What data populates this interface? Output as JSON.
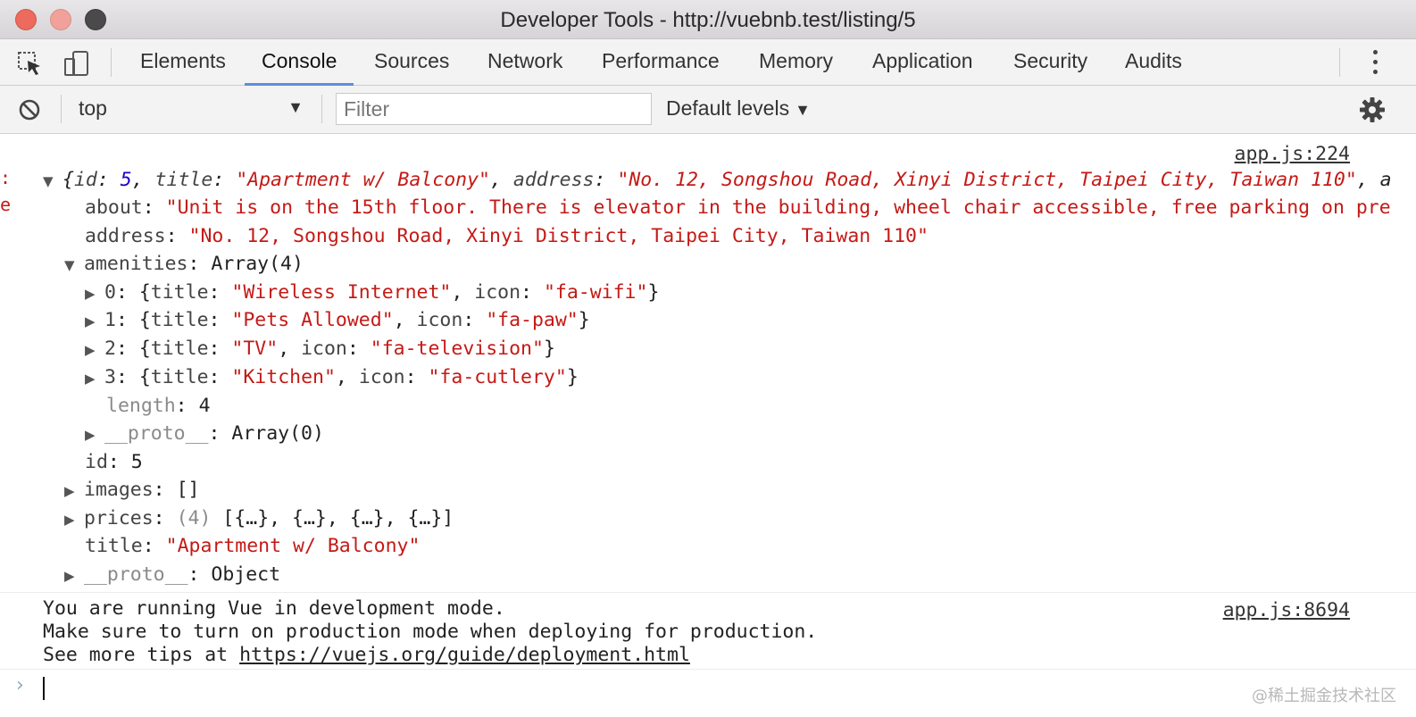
{
  "window": {
    "title": "Developer Tools - http://vuebnb.test/listing/5"
  },
  "tabs": [
    "Elements",
    "Console",
    "Sources",
    "Network",
    "Performance",
    "Memory",
    "Application",
    "Security",
    "Audits"
  ],
  "active_tab": "Console",
  "filterbar": {
    "context": "top",
    "filter_placeholder": "Filter",
    "levels": "Default levels"
  },
  "console": {
    "log1": {
      "source": "app.js:224",
      "summary": {
        "id_key": "id",
        "id_val": "5",
        "title_key": "title",
        "title_val": "\"Apartment w/ Balcony\"",
        "address_key": "address",
        "address_val": "\"No. 12, Songshou Road, Xinyi District, Taipei City, Taiwan 110\"",
        "trail": ", a"
      },
      "about_key": "about",
      "about_val": "\"Unit is on the 15th floor. There is elevator in the building, wheel chair accessible, free parking on pre",
      "address_key": "address",
      "address_val": "\"No. 12, Songshou Road, Xinyi District, Taipei City, Taiwan 110\"",
      "amenities_key": "amenities",
      "amenities_type": "Array(4)",
      "amenities": [
        {
          "index": "0",
          "title": "\"Wireless Internet\"",
          "icon": "\"fa-wifi\""
        },
        {
          "index": "1",
          "title": "\"Pets Allowed\"",
          "icon": "\"fa-paw\""
        },
        {
          "index": "2",
          "title": "\"TV\"",
          "icon": "\"fa-television\""
        },
        {
          "index": "3",
          "title": "\"Kitchen\"",
          "icon": "\"fa-cutlery\""
        }
      ],
      "length_key": "length",
      "length_val": "4",
      "proto_key": "__proto__",
      "arr_proto_val": "Array(0)",
      "id_key": "id",
      "id_val": "5",
      "images_key": "images",
      "images_val": "[]",
      "prices_key": "prices",
      "prices_count": "(4)",
      "prices_val": "[{…}, {…}, {…}, {…}]",
      "title_key": "title",
      "title_val": "\"Apartment w/ Balcony\"",
      "obj_proto_val": "Object"
    },
    "log2": {
      "source": "app.js:8694",
      "line1": "You are running Vue in development mode.",
      "line2": "Make sure to turn on production mode when deploying for production.",
      "line3_prefix": "See more tips at ",
      "line3_link": "https://vuejs.org/guide/deployment.html"
    },
    "prompt": "›"
  },
  "watermark": "@稀土掘金技术社区"
}
